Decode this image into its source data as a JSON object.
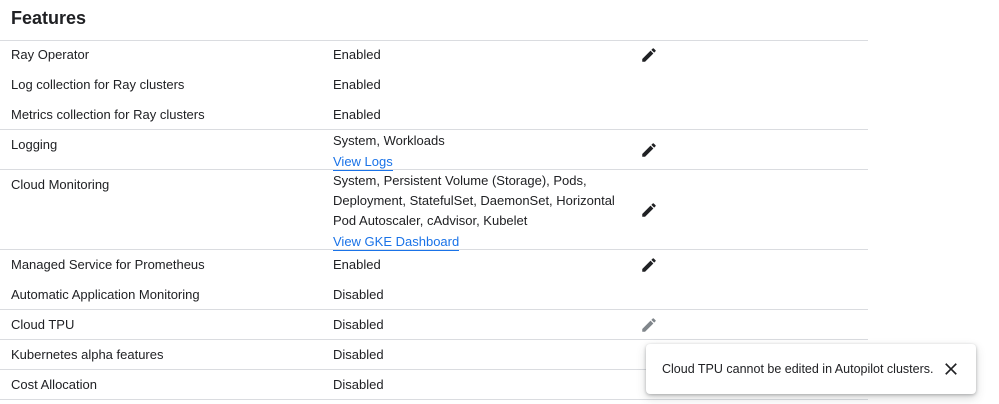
{
  "section": {
    "title": "Features"
  },
  "rows": [
    {
      "label": "Ray Operator",
      "value": [
        "Enabled"
      ],
      "editable": true
    },
    {
      "label": "Log collection for Ray clusters",
      "value": [
        "Enabled"
      ]
    },
    {
      "label": "Metrics collection for Ray clusters",
      "value": [
        "Enabled"
      ]
    },
    {
      "label": "Logging",
      "value": [
        "System, Workloads"
      ],
      "link": "View Logs",
      "editable": true
    },
    {
      "label": "Cloud Monitoring",
      "value": [
        "System, Persistent Volume (Storage), Pods,",
        "Deployment, StatefulSet, DaemonSet, Horizontal",
        "Pod Autoscaler, cAdvisor, Kubelet"
      ],
      "link": "View GKE Dashboard",
      "editable": true
    },
    {
      "label": "Managed Service for Prometheus",
      "value": [
        "Enabled"
      ],
      "editable": true
    },
    {
      "label": "Automatic Application Monitoring",
      "value": [
        "Disabled"
      ]
    },
    {
      "label": "Cloud TPU",
      "value": [
        "Disabled"
      ],
      "editable": false
    },
    {
      "label": "Kubernetes alpha features",
      "value": [
        "Disabled"
      ]
    },
    {
      "label": "Cost Allocation",
      "value": [
        "Disabled"
      ]
    }
  ],
  "toast": {
    "message": "Cloud TPU cannot be edited in Autopilot clusters."
  },
  "icons": {
    "edit": "edit-pencil-icon",
    "close": "close-icon"
  },
  "colors": {
    "link": "#1a73e8",
    "divider": "#dadce0",
    "edit_enabled": "#202124",
    "edit_disabled": "#80868b"
  }
}
